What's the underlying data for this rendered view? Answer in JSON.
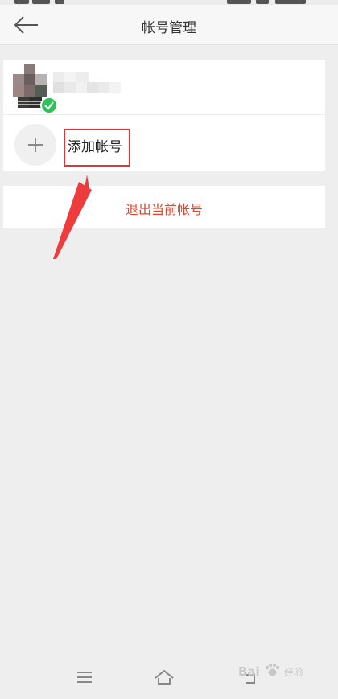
{
  "header": {
    "title": "帐号管理",
    "back_icon": "arrow-left-icon"
  },
  "accounts": [
    {
      "name": "",
      "avatar": "blurred-avatar",
      "active": true,
      "active_icon": "check-circle-icon"
    }
  ],
  "add_account": {
    "label": "添加帐号",
    "icon": "plus-icon"
  },
  "logout": {
    "label": "退出当前帐号",
    "color": "#e8442c"
  },
  "annotation": {
    "highlight_color": "#e63232",
    "arrow_color": "#ee3b3b"
  },
  "navbar": {
    "items": [
      "menu-icon",
      "home-icon",
      "back-icon"
    ]
  },
  "watermark": {
    "brand": "Bai",
    "paw_icon": "paw-icon",
    "text": "经验"
  }
}
